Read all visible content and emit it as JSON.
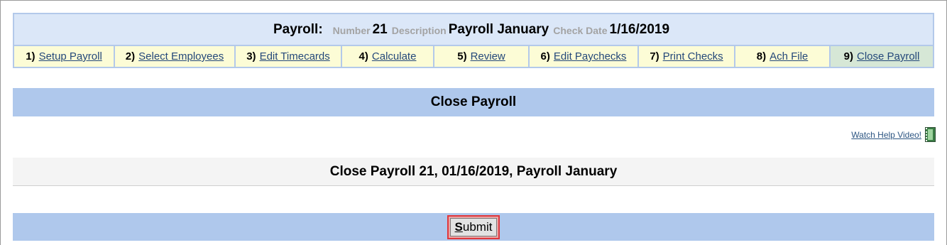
{
  "header": {
    "title": "Payroll:",
    "number_label": "Number",
    "number_value": "21",
    "description_label": "Description",
    "description_value": "Payroll January",
    "check_date_label": "Check Date",
    "check_date_value": "1/16/2019"
  },
  "steps": [
    {
      "num": "1)",
      "label": "Setup Payroll"
    },
    {
      "num": "2)",
      "label": "Select Employees"
    },
    {
      "num": "3)",
      "label": "Edit Timecards"
    },
    {
      "num": "4)",
      "label": "Calculate"
    },
    {
      "num": "5)",
      "label": "Review"
    },
    {
      "num": "6)",
      "label": "Edit Paychecks"
    },
    {
      "num": "7)",
      "label": "Print Checks"
    },
    {
      "num": "8)",
      "label": "Ach File"
    },
    {
      "num": "9)",
      "label": "Close Payroll"
    }
  ],
  "active_step": "9)",
  "section": {
    "title": "Close Payroll"
  },
  "help": {
    "link": "Watch Help Video!",
    "icon": "film-icon"
  },
  "info": {
    "text": "Close Payroll 21, 01/16/2019, Payroll January"
  },
  "submit": {
    "first_letter": "S",
    "rest": "ubmit"
  }
}
